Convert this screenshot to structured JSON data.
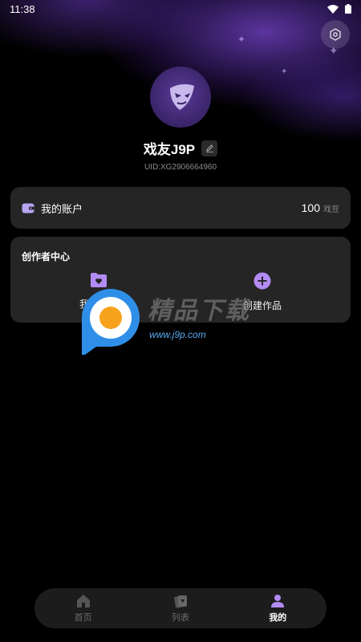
{
  "status": {
    "time": "11:38"
  },
  "profile": {
    "name": "戏友J9P",
    "uid": "UID:XG2906664960"
  },
  "account": {
    "label": "我的账户",
    "balance": "100",
    "unit": "戏豆"
  },
  "creator": {
    "title": "创作者中心",
    "items": [
      {
        "label": "我的作品",
        "icon": "folder-heart-icon"
      },
      {
        "label": "创建作品",
        "icon": "plus-circle-icon"
      }
    ]
  },
  "watermark": {
    "text": "精品下载",
    "url": "www.j9p.com"
  },
  "nav": {
    "items": [
      {
        "label": "首页",
        "icon": "home-icon"
      },
      {
        "label": "列表",
        "icon": "cards-icon"
      },
      {
        "label": "我的",
        "icon": "user-icon"
      }
    ],
    "active_index": 2
  },
  "colors": {
    "accent": "#8b5cf6",
    "card": "#252525",
    "background": "#000000"
  }
}
